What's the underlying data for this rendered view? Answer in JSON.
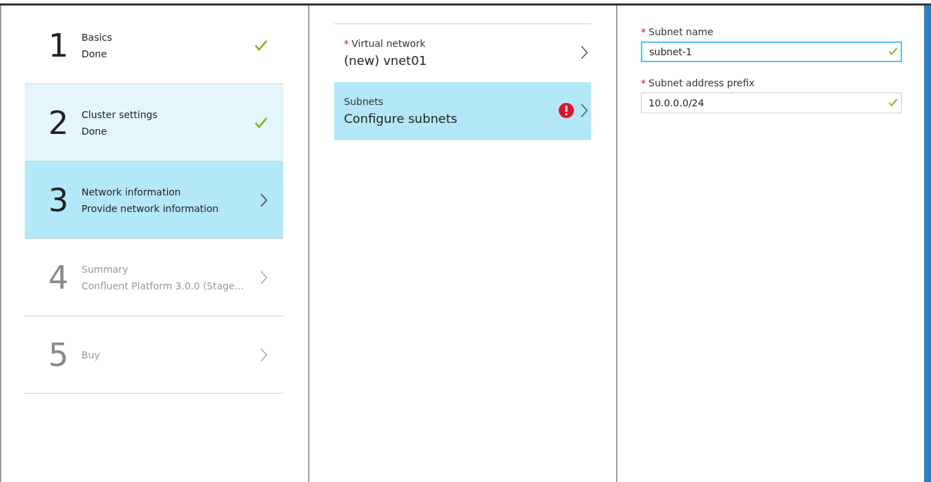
{
  "steps": [
    {
      "number": "1",
      "title": "Basics",
      "subtitle": "Done",
      "done": true,
      "selected": false,
      "visited": false,
      "disabled": false
    },
    {
      "number": "2",
      "title": "Cluster settings",
      "subtitle": "Done",
      "done": true,
      "selected": false,
      "visited": true,
      "disabled": false
    },
    {
      "number": "3",
      "title": "Network information",
      "subtitle": "Provide network information",
      "done": false,
      "selected": true,
      "visited": false,
      "disabled": false
    },
    {
      "number": "4",
      "title": "Summary",
      "subtitle": "Confluent Platform 3.0.0 (Stage...",
      "done": false,
      "selected": false,
      "visited": false,
      "disabled": true
    },
    {
      "number": "5",
      "title": "Buy",
      "done": false,
      "selected": false,
      "visited": false,
      "disabled": true
    }
  ],
  "network_settings": [
    {
      "required_mark": "*",
      "label": "Virtual network",
      "value": "(new) vnet01",
      "selected": false,
      "error": false
    },
    {
      "label": "Subnets",
      "value": "Configure subnets",
      "selected": true,
      "error": true
    }
  ],
  "subnet_form": [
    {
      "required_mark": "*",
      "label": "Subnet name",
      "value": "subnet-1",
      "focused": true,
      "valid": true
    },
    {
      "required_mark": "*",
      "label": "Subnet address prefix",
      "value": "10.0.0.0/24",
      "focused": false,
      "valid": true
    }
  ]
}
